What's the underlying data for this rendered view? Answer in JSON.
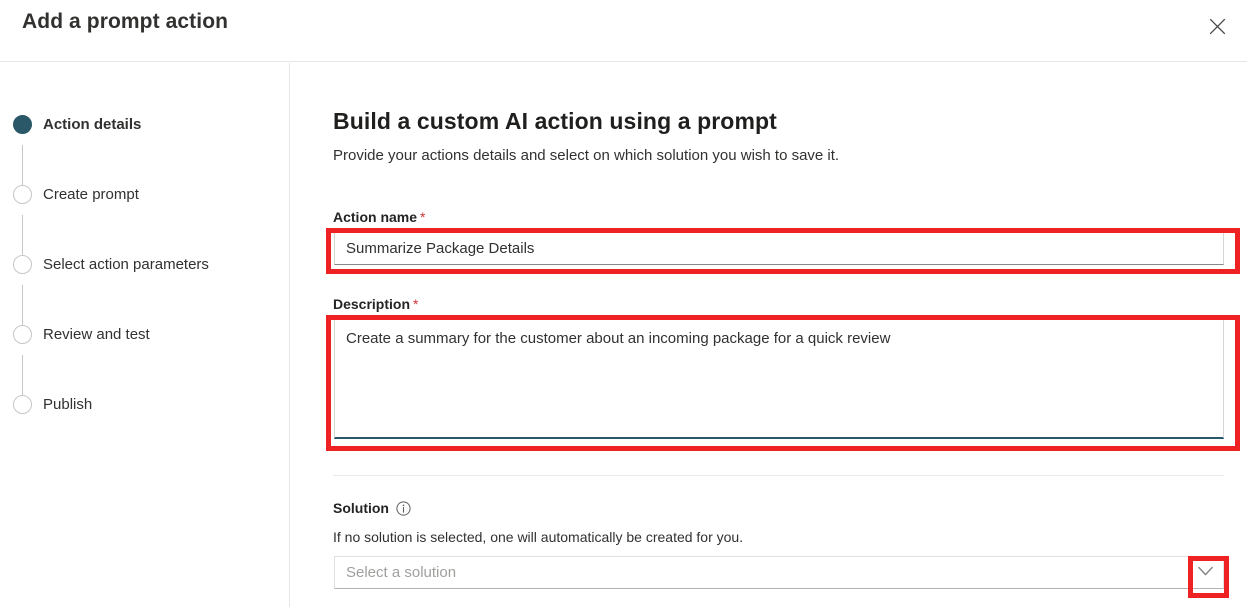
{
  "dialog": {
    "title": "Add a prompt action",
    "close_icon": "close-icon",
    "close_label": "Close"
  },
  "stepper": {
    "steps": [
      {
        "label": "Action details",
        "state": "active"
      },
      {
        "label": "Create prompt",
        "state": "inactive"
      },
      {
        "label": "Select action parameters",
        "state": "inactive"
      },
      {
        "label": "Review and test",
        "state": "inactive"
      },
      {
        "label": "Publish",
        "state": "inactive"
      }
    ]
  },
  "main": {
    "title": "Build a custom AI action using a prompt",
    "subtitle": "Provide your actions details and select on which solution you wish to save it.",
    "fields": {
      "action_name": {
        "label": "Action name",
        "required_marker": "*",
        "value": "Summarize Package Details",
        "placeholder": ""
      },
      "description": {
        "label": "Description",
        "required_marker": "*",
        "value": "Create a summary for the customer about an incoming package for a quick review",
        "placeholder": ""
      },
      "solution": {
        "label": "Solution",
        "info_icon": "info-icon",
        "hint": "If no solution is selected, one will automatically be created for you.",
        "placeholder": "Select a solution",
        "value": "Select a solution",
        "chevron_icon": "chevron-down-icon"
      }
    }
  },
  "annotations": {
    "color": "#ee2222",
    "targets": [
      "action-name-input",
      "description-textarea",
      "solution-dropdown-chevron"
    ]
  },
  "colors": {
    "accent": "#2a5868",
    "required": "#d13438",
    "annotation": "#ee2222",
    "text": "#323130"
  }
}
